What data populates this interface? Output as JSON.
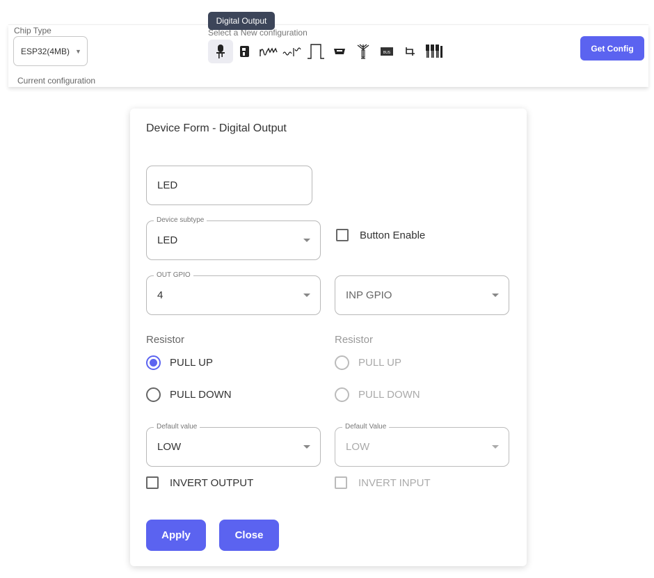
{
  "tooltip": "Digital Output",
  "topbar": {
    "chip_type_label": "Chip Type",
    "chip_type_value": "ESP32(4MB)",
    "current_config_label": "Current configuration",
    "new_config_label": "Select a New configuration",
    "get_config_label": "Get Config",
    "config_icons": [
      {
        "name": "digital-output-led-icon",
        "active": true
      },
      {
        "name": "digital-input-switch-icon"
      },
      {
        "name": "pwm-output-icon"
      },
      {
        "name": "analog-input-icon"
      },
      {
        "name": "pulse-waveform-icon"
      },
      {
        "name": "serial-connector-icon"
      },
      {
        "name": "antenna-icon"
      },
      {
        "name": "bus-icon",
        "text": "BUS"
      },
      {
        "name": "i2c-icon"
      },
      {
        "name": "multi-pin-header-icon"
      }
    ]
  },
  "form": {
    "title": "Device Form - Digital Output",
    "name_value": "LED",
    "device_subtype": {
      "label": "Device subtype",
      "value": "LED"
    },
    "button_enable_label": "Button Enable",
    "out_gpio": {
      "label": "OUT GPIO",
      "value": "4"
    },
    "inp_gpio": {
      "placeholder": "INP GPIO"
    },
    "left_resistor": {
      "label": "Resistor",
      "options": [
        "PULL UP",
        "PULL DOWN"
      ],
      "selected": "PULL UP"
    },
    "right_resistor": {
      "label": "Resistor",
      "options": [
        "PULL UP",
        "PULL DOWN"
      ]
    },
    "default_value_left": {
      "label": "Default value",
      "value": "LOW"
    },
    "default_value_right": {
      "label": "Default Value",
      "value": "LOW"
    },
    "invert_output_label": "INVERT OUTPUT",
    "invert_input_label": "INVERT INPUT",
    "apply_label": "Apply",
    "close_label": "Close"
  },
  "colors": {
    "accent": "#5b63f0",
    "tooltip_bg": "#3c4559"
  }
}
